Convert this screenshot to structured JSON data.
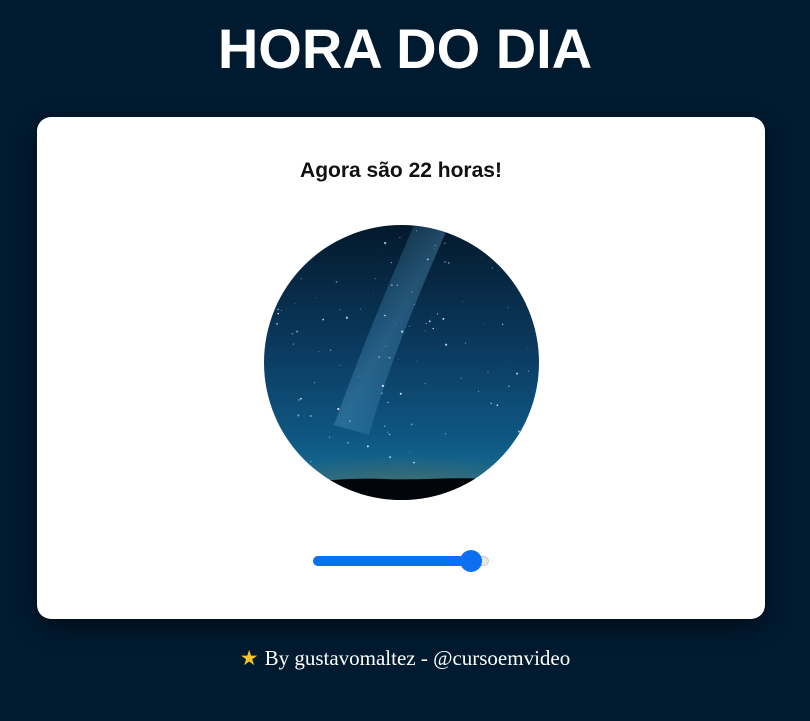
{
  "header": {
    "title": "HORA DO DIA"
  },
  "card": {
    "message": "Agora são 22 horas!",
    "image": {
      "icon": "night-sky-photo",
      "alt": ""
    },
    "slider": {
      "value": 22,
      "min": 0,
      "max": 23
    }
  },
  "footer": {
    "star_icon": "★",
    "text": "By gustavomaltez - @cursoemvideo"
  },
  "colors": {
    "background": "#001a30",
    "card": "#ffffff",
    "accent": "#0a6ff0",
    "star": "#f6c12a"
  }
}
